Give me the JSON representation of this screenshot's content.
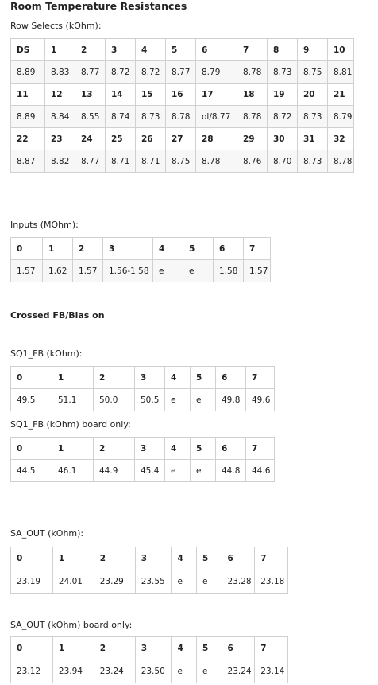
{
  "title": "Room Temperature Resistances",
  "row_selects": {
    "label": "Row Selects (kOhm):",
    "rows": [
      [
        "DS",
        "1",
        "2",
        "3",
        "4",
        "5",
        "6",
        "7",
        "8",
        "9",
        "10"
      ],
      [
        "8.89",
        "8.83",
        "8.77",
        "8.72",
        "8.72",
        "8.77",
        "8.79",
        "8.78",
        "8.73",
        "8.75",
        "8.81"
      ],
      [
        "11",
        "12",
        "13",
        "14",
        "15",
        "16",
        "17",
        "18",
        "19",
        "20",
        "21"
      ],
      [
        "8.89",
        "8.84",
        "8.55",
        "8.74",
        "8.73",
        "8.78",
        "ol/8.77",
        "8.78",
        "8.72",
        "8.73",
        "8.79"
      ],
      [
        "22",
        "23",
        "24",
        "25",
        "26",
        "27",
        "28",
        "29",
        "30",
        "31",
        "32"
      ],
      [
        "8.87",
        "8.82",
        "8.77",
        "8.71",
        "8.71",
        "8.75",
        "8.78",
        "8.76",
        "8.70",
        "8.73",
        "8.78"
      ]
    ]
  },
  "inputs": {
    "label": "Inputs (MOhm):",
    "rows": [
      [
        "0",
        "1",
        "2",
        "3",
        "4",
        "5",
        "6",
        "7"
      ],
      [
        "1.57",
        "1.62",
        "1.57",
        "1.56-1.58",
        "e",
        "e",
        "1.58",
        "1.57"
      ]
    ]
  },
  "crossed_heading": "Crossed FB/Bias on",
  "sq1_fb": {
    "label": "SQ1_FB (kOhm):",
    "rows": [
      [
        "0",
        "1",
        "2",
        "3",
        "4",
        "5",
        "6",
        "7"
      ],
      [
        "49.5",
        "51.1",
        "50.0",
        "50.5",
        "e",
        "e",
        "49.8",
        "49.6"
      ]
    ]
  },
  "sq1_fb_board": {
    "label": "SQ1_FB (kOhm) board only:",
    "rows": [
      [
        "0",
        "1",
        "2",
        "3",
        "4",
        "5",
        "6",
        "7"
      ],
      [
        "44.5",
        "46.1",
        "44.9",
        "45.4",
        "e",
        "e",
        "44.8",
        "44.6"
      ]
    ]
  },
  "sa_out": {
    "label": "SA_OUT (kOhm):",
    "rows": [
      [
        "0",
        "1",
        "2",
        "3",
        "4",
        "5",
        "6",
        "7"
      ],
      [
        "23.19",
        "24.01",
        "23.29",
        "23.55",
        "e",
        "e",
        "23.28",
        "23.18"
      ]
    ]
  },
  "sa_out_board": {
    "label": "SA_OUT (kOhm) board only:",
    "rows": [
      [
        "0",
        "1",
        "2",
        "3",
        "4",
        "5",
        "6",
        "7"
      ],
      [
        "23.12",
        "23.94",
        "23.24",
        "23.50",
        "e",
        "e",
        "23.24",
        "23.14"
      ]
    ]
  }
}
